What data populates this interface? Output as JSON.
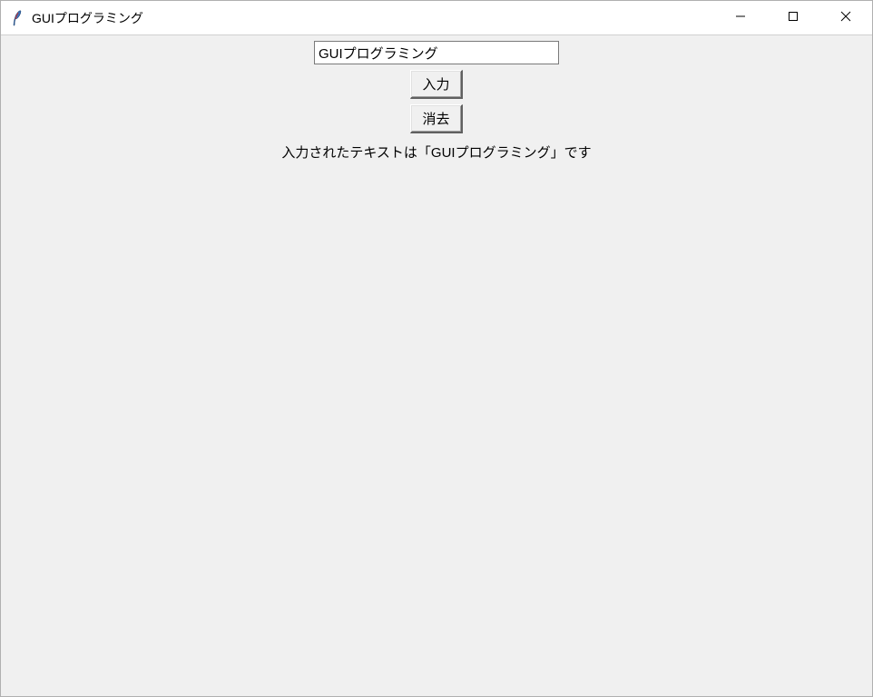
{
  "window": {
    "title": "GUIプログラミング"
  },
  "form": {
    "entry_value": "GUIプログラミング",
    "input_button_label": "入力",
    "clear_button_label": "消去",
    "result_text": "入力されたテキストは「GUIプログラミング」です"
  }
}
